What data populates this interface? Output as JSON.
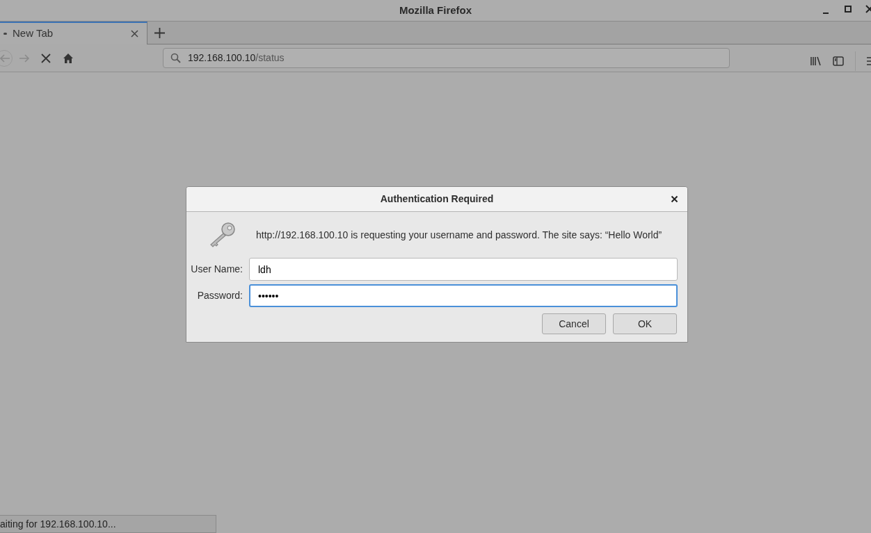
{
  "window": {
    "title": "Mozilla Firefox"
  },
  "tabs": [
    {
      "label": "New Tab",
      "selected": true,
      "loading": true
    }
  ],
  "toolbar": {
    "url_host": "192.168.100.10",
    "url_path": "/status"
  },
  "dialog": {
    "title": "Authentication Required",
    "message": "http://192.168.100.10 is requesting your username and password. The site says: “Hello World”",
    "fields": [
      {
        "label": "User Name:",
        "value": "ldh",
        "focused": false
      },
      {
        "label": "Password:",
        "value": "••••••",
        "focused": true
      }
    ],
    "buttons": [
      "Cancel",
      "OK"
    ]
  },
  "status_bar": "aiting for 192.168.100.10..."
}
